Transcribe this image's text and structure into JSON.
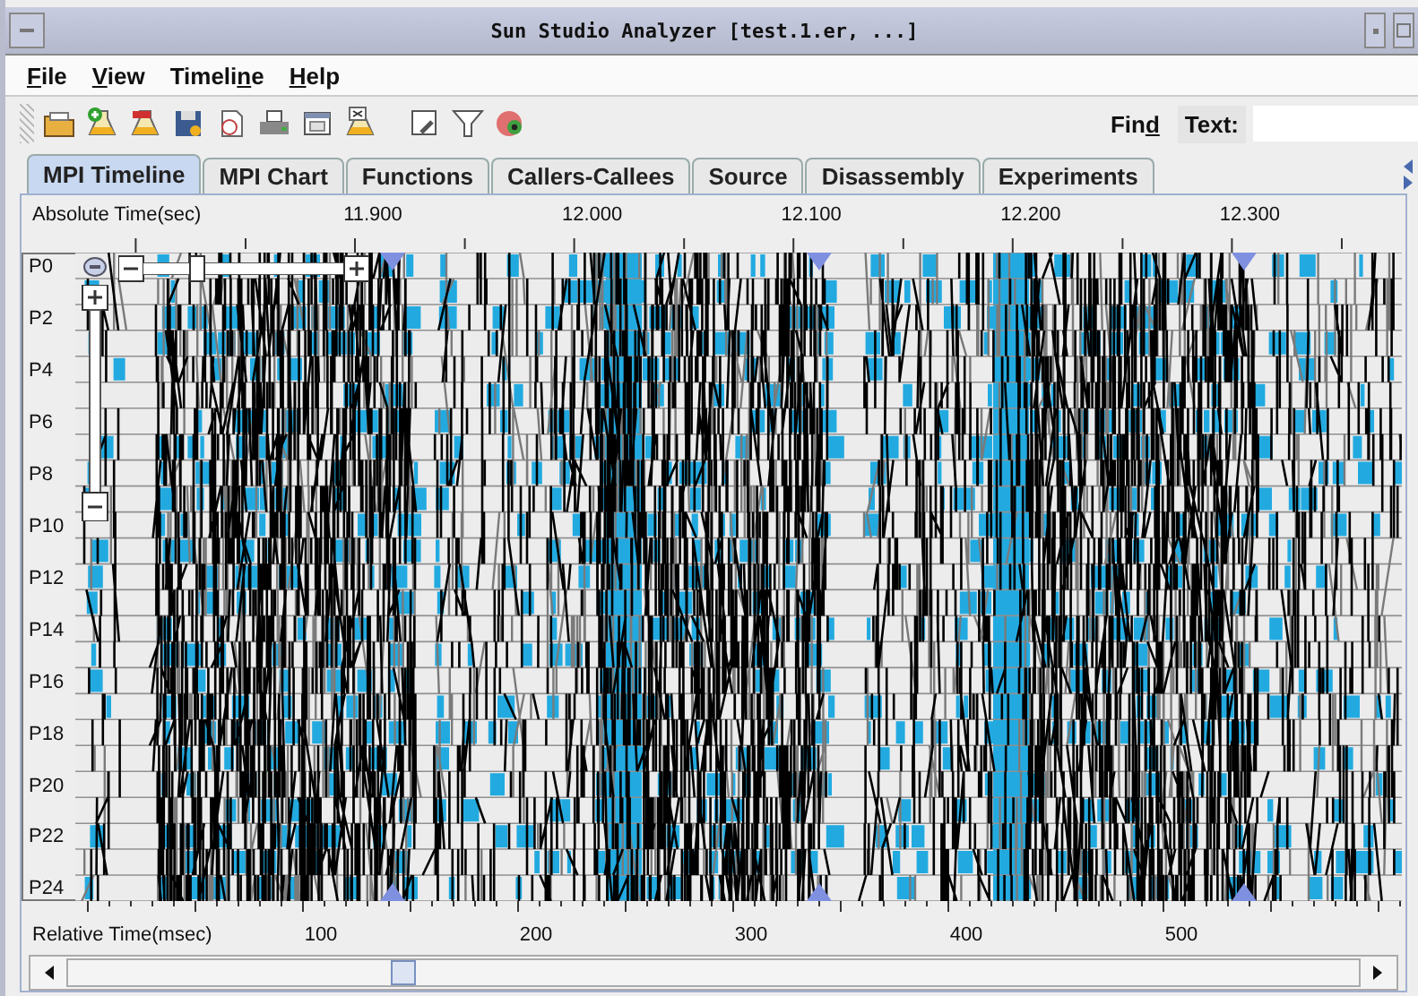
{
  "window": {
    "title": "Sun Studio Analyzer [test.1.er, ...]"
  },
  "menu": [
    {
      "key": "F",
      "after": "ile"
    },
    {
      "key": "V",
      "after": "iew"
    },
    {
      "before": "Timeli",
      "key": "n",
      "after": "e"
    },
    {
      "key": "H",
      "after": "elp"
    }
  ],
  "find": {
    "before": "Fin",
    "key": "d",
    "field_label": "Text:"
  },
  "tabs": [
    {
      "label": "MPI Timeline",
      "selected": true
    },
    {
      "label": "MPI Chart",
      "selected": false
    },
    {
      "label": "Functions",
      "selected": false
    },
    {
      "label": "Callers-Callees",
      "selected": false
    },
    {
      "label": "Source",
      "selected": false
    },
    {
      "label": "Disassembly",
      "selected": false
    },
    {
      "label": "Experiments",
      "selected": false
    }
  ],
  "timeline": {
    "absolute_axis": {
      "title": "Absolute Time(sec)",
      "ticks": [
        "11.900",
        "12.000",
        "12.100",
        "12.200",
        "12.300"
      ]
    },
    "rows": [
      "P0",
      "P2",
      "P4",
      "P6",
      "P8",
      "P10",
      "P12",
      "P14",
      "P16",
      "P18",
      "P20",
      "P22",
      "P24"
    ],
    "relative_axis": {
      "title": "Relative Time(msec)",
      "ticks": [
        "100",
        "200",
        "300",
        "400",
        "500"
      ]
    },
    "zoom_slider": {
      "level": 0.25
    }
  }
}
